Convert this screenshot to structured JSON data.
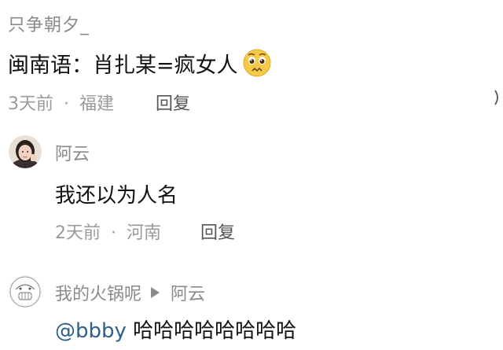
{
  "comments": [
    {
      "username": "只争朝夕_",
      "text": "闽南语：肖扎某=疯女人",
      "emoji": "pleading-face-emoji",
      "time": "3天前",
      "separator": "·",
      "location": "福建",
      "reply_label": "回复"
    },
    {
      "username": "阿云",
      "text": "我还以为人名",
      "time": "2天前",
      "separator": "·",
      "location": "河南",
      "reply_label": "回复"
    },
    {
      "username": "我的火锅呢",
      "reply_to": "阿云",
      "mention": "@bbby",
      "text": " 哈哈哈哈哈哈哈哈"
    }
  ],
  "colors": {
    "meta": "#9a9a9a",
    "username": "#8a8a8a",
    "mention": "#2f5f8a",
    "text": "#111111"
  }
}
